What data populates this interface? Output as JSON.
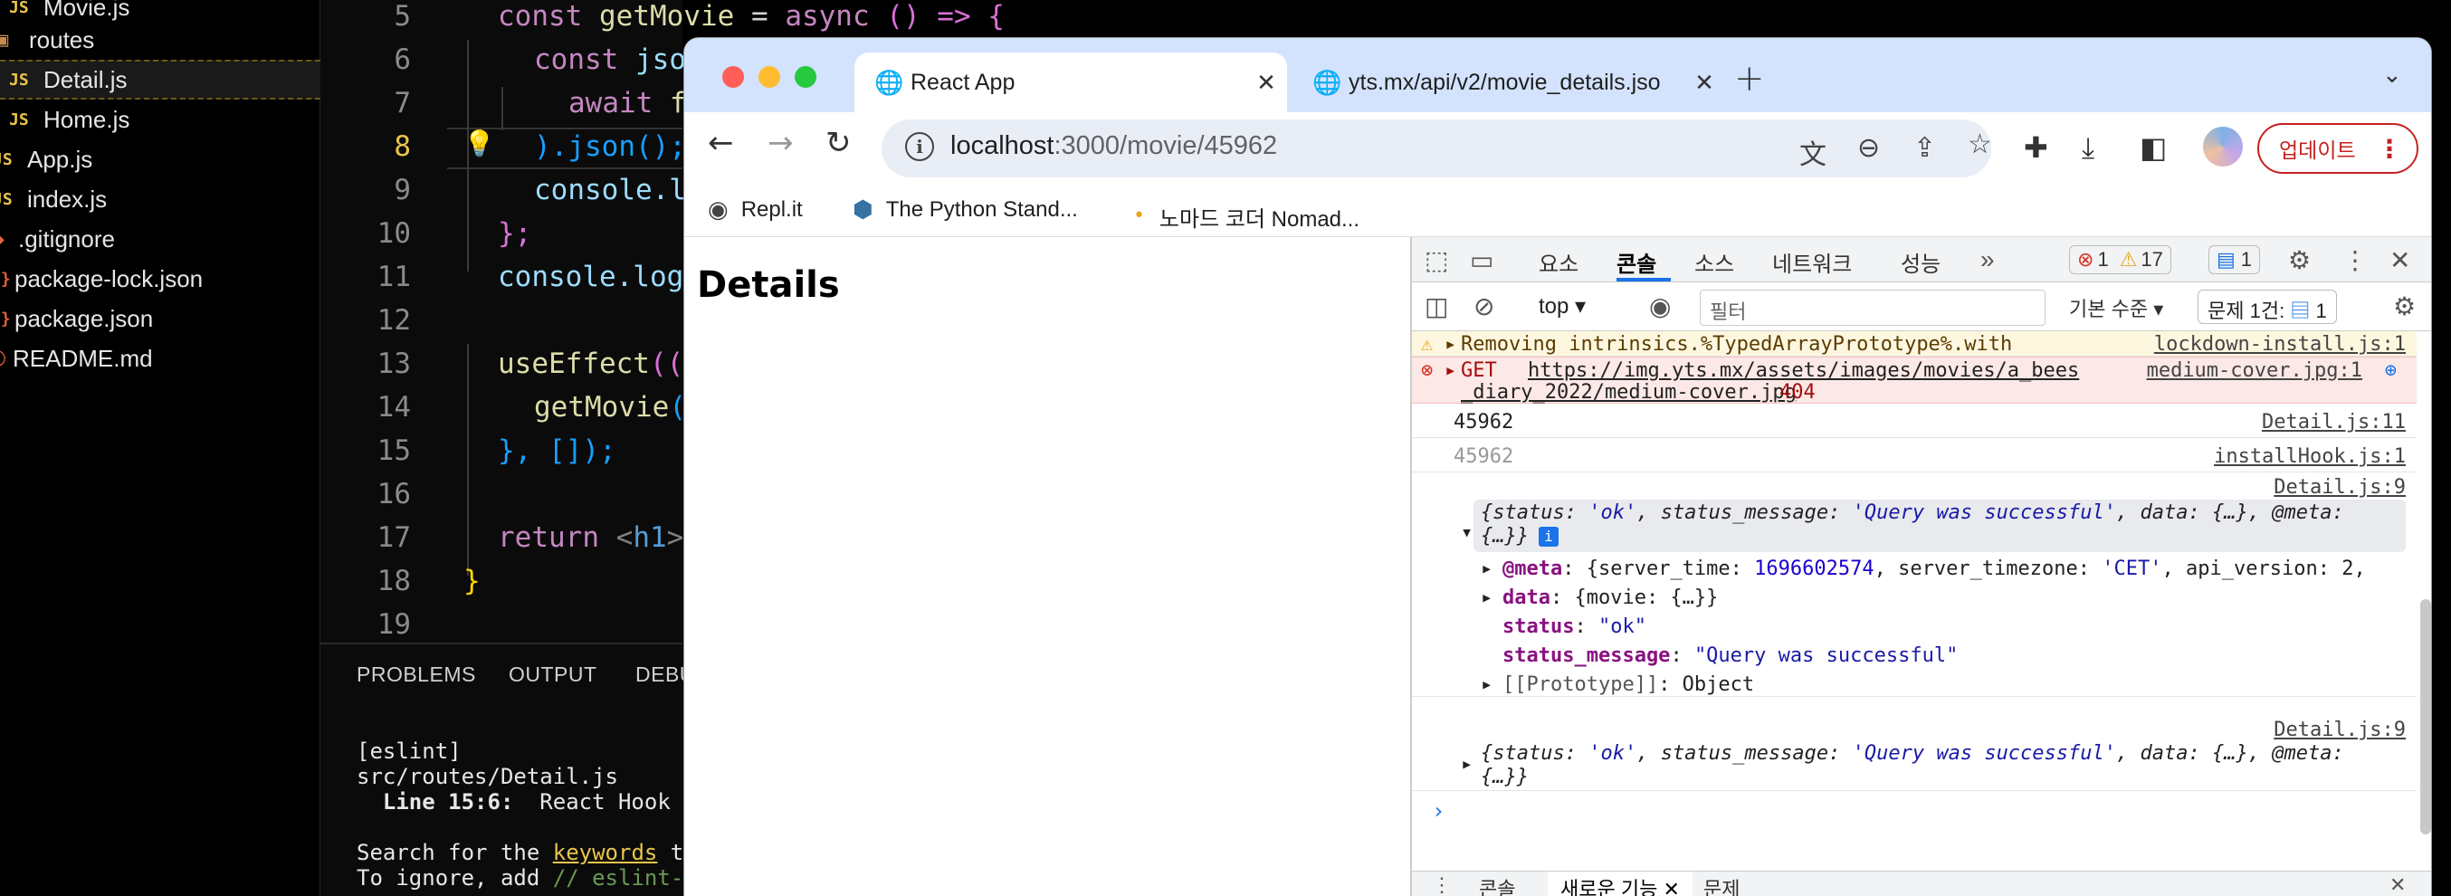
{
  "sidebar": {
    "files": [
      {
        "icon": "JS",
        "name": "Movie.js"
      },
      {
        "icon": "▣",
        "name": "routes"
      },
      {
        "icon": "JS",
        "name": "Detail.js"
      },
      {
        "icon": "JS",
        "name": "Home.js"
      },
      {
        "icon": "JS",
        "name": "App.js"
      },
      {
        "icon": "JS",
        "name": "index.js"
      },
      {
        "icon": "◆",
        "name": ".gitignore"
      },
      {
        "icon": "{}",
        "name": "package-lock.json"
      },
      {
        "icon": "{}",
        "name": "package.json"
      },
      {
        "icon": "ⓘ",
        "name": "README.md"
      }
    ]
  },
  "editor": {
    "line_numbers": [
      "5",
      "6",
      "7",
      "8",
      "9",
      "10",
      "11",
      "12",
      "13",
      "14",
      "15",
      "16",
      "17",
      "18",
      "19"
    ],
    "lines": {
      "l5": {
        "kw": "const",
        "fn": "getMovie",
        "op": " = ",
        "kw2": "async",
        "rest": " () => {"
      },
      "l6": {
        "kw": "const",
        "var": " jso"
      },
      "l7": {
        "kw": "await",
        "rest": " f"
      },
      "l8": {
        "text": ").json();"
      },
      "l9": {
        "text": "console.l"
      },
      "l10": {
        "text": "};"
      },
      "l11": {
        "text": "console.log"
      },
      "l13": {
        "fn": "useEffect",
        "rest": "(("
      },
      "l14": {
        "fn": "getMovie",
        "rest": "("
      },
      "l15": {
        "text": "}, []);"
      },
      "l17": {
        "kw": "return",
        "tag": " <",
        "tagn": "h1",
        "tag2": ">"
      },
      "l18": {
        "text": "}"
      }
    }
  },
  "panel": {
    "tabs": [
      "PROBLEMS",
      "OUTPUT",
      "DEBU"
    ],
    "terminal": {
      "line1": "[eslint]",
      "line2": "src/routes/Detail.js",
      "line3_bold": "  Line 15:6:",
      "line3_rest": "  React Hook u",
      "line4_a": "Search for the ",
      "line4_hl": "keywords",
      "line4_b": " to",
      "line5_a": "To ignore, add ",
      "line5_cm": "// eslint-d"
    }
  },
  "browser": {
    "tabs": [
      {
        "label": "React App",
        "active": true
      },
      {
        "label": "yts.mx/api/v2/movie_details.jso",
        "active": false
      }
    ],
    "url_host": "localhost",
    "url_path": ":3000/movie/45962",
    "update_label": "업데이트",
    "bookmarks": [
      "Repl.it",
      "The Python Stand...",
      "노마드 코더 Nomad..."
    ],
    "page_heading": "Details"
  },
  "devtools": {
    "tabs": [
      "요소",
      "콘솔",
      "소스",
      "네트워크",
      "성능"
    ],
    "active_tab": "콘솔",
    "error_count": "1",
    "warning_count": "17",
    "info_count": "1",
    "context": "top",
    "filter_placeholder": "필터",
    "levels_label": "기본 수준",
    "issues_label": "문제 1건:",
    "issues_count": "1",
    "console": {
      "warn_text": "Removing intrinsics.%TypedArrayPrototype%.with",
      "warn_src": "lockdown-install.js:1",
      "err_prefix": "GET",
      "err_url1": "https://img.yts.mx/assets/images/movies/a_bees",
      "err_url2": "_diary_2022/medium-cover.jpg",
      "err_code": "404",
      "err_src": "medium-cover.jpg:1",
      "log1": "45962",
      "log1_src": "Detail.js:11",
      "log2": "45962",
      "log2_src": "installHook.js:1",
      "obj_src": "Detail.js:9",
      "obj_line_a": "{status: ",
      "obj_ok": "'ok'",
      "obj_mid": ", status_message: ",
      "obj_msg": "'Query was successful'",
      "obj_tail": ", data: {…}, @meta:",
      "obj_line2": "{…}}",
      "meta_key": "@meta",
      "meta_a": ": {server_time: ",
      "meta_time": "1696602574",
      "meta_b": ", server_timezone: ",
      "meta_tz": "'CET'",
      "meta_c": ", api_version: 2,",
      "data_key": "data",
      "data_val": ": {movie: {…}}",
      "status_key": "status",
      "status_val": "\"ok\"",
      "sm_key": "status_message",
      "sm_val": "\"Query was successful\"",
      "proto_key": "[[Prototype]]",
      "proto_val": ": Object",
      "obj2_src": "Detail.js:9"
    },
    "drawer_tabs": [
      "콘솔",
      "새로운 기능",
      "문제"
    ]
  }
}
